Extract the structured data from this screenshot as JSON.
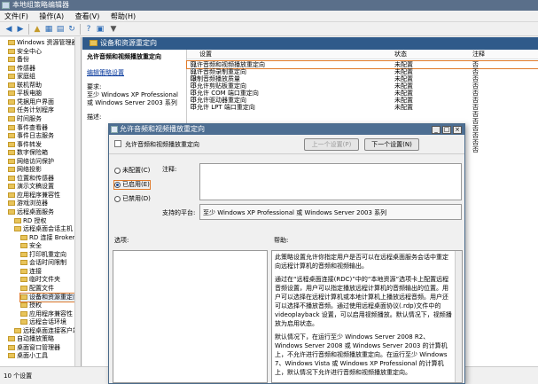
{
  "window": {
    "title": "本地组策略编辑器",
    "menu": [
      "文件(F)",
      "操作(A)",
      "查看(V)",
      "帮助(H)"
    ]
  },
  "tree": {
    "items": [
      {
        "label": "Windows 资源管理器",
        "indent": 1
      },
      {
        "label": "安全中心",
        "indent": 1
      },
      {
        "label": "备份",
        "indent": 1
      },
      {
        "label": "传感器",
        "indent": 1
      },
      {
        "label": "家庭组",
        "indent": 1
      },
      {
        "label": "联机帮助",
        "indent": 1
      },
      {
        "label": "平板电脑",
        "indent": 1
      },
      {
        "label": "凭据用户界面",
        "indent": 1
      },
      {
        "label": "任务计划程序",
        "indent": 1
      },
      {
        "label": "时间服务",
        "indent": 1
      },
      {
        "label": "事件查看器",
        "indent": 1
      },
      {
        "label": "事件日志服务",
        "indent": 1
      },
      {
        "label": "事件转发",
        "indent": 1
      },
      {
        "label": "数字保险箱",
        "indent": 1
      },
      {
        "label": "网络访问保护",
        "indent": 1
      },
      {
        "label": "网络投影",
        "indent": 1
      },
      {
        "label": "位置和传感器",
        "indent": 1
      },
      {
        "label": "演示文稿设置",
        "indent": 1
      },
      {
        "label": "应用程序兼容性",
        "indent": 1
      },
      {
        "label": "游戏浏览器",
        "indent": 1
      },
      {
        "label": "远程桌面服务",
        "indent": 1
      },
      {
        "label": "RD 授权",
        "indent": 2
      },
      {
        "label": "远程桌面会话主机",
        "indent": 2
      },
      {
        "label": "RD 连接 Broker",
        "indent": 3
      },
      {
        "label": "安全",
        "indent": 3
      },
      {
        "label": "打印机重定向",
        "indent": 3
      },
      {
        "label": "会话时间限制",
        "indent": 3
      },
      {
        "label": "连接",
        "indent": 3
      },
      {
        "label": "临时文件夹",
        "indent": 3
      },
      {
        "label": "配置文件",
        "indent": 3
      },
      {
        "label": "设备和资源重定向",
        "indent": 3,
        "selected": true
      },
      {
        "label": "授权",
        "indent": 3
      },
      {
        "label": "应用程序兼容性",
        "indent": 3
      },
      {
        "label": "远程会话环境",
        "indent": 3
      },
      {
        "label": "远程桌面连接客户端",
        "indent": 2
      },
      {
        "label": "自动播放策略",
        "indent": 1
      },
      {
        "label": "桌面窗口管理器",
        "indent": 1
      },
      {
        "label": "桌面小工具",
        "indent": 1
      }
    ]
  },
  "right": {
    "header": "设备和资源重定向",
    "ext_title": "允许音频和视频播放重定向",
    "ext_edit_link": "编辑策略设置",
    "ext_req_label": "要求:",
    "ext_req_text": "至少 Windows XP Professional 或 Windows Server 2003 系列",
    "ext_desc_label": "描述:",
    "columns": [
      "设置",
      "状态",
      "注释"
    ],
    "rows": [
      {
        "setting": "允许音频和视频播放重定向",
        "state": "未配置",
        "note": "否",
        "selected": true
      },
      {
        "setting": "允许音频录制重定向",
        "state": "未配置",
        "note": "否"
      },
      {
        "setting": "限制音频播放质量",
        "state": "未配置",
        "note": "否"
      },
      {
        "setting": "不允许剪贴板重定向",
        "state": "未配置",
        "note": "否"
      },
      {
        "setting": "不允许 COM 端口重定向",
        "state": "未配置",
        "note": "否"
      },
      {
        "setting": "不允许驱动器重定向",
        "state": "未配置",
        "note": "否"
      },
      {
        "setting": "不允许 LPT 端口重定向",
        "state": "未配置",
        "note": "否"
      }
    ],
    "extra_notes": [
      "否",
      "否",
      "否",
      "否",
      "否",
      "否"
    ]
  },
  "status": {
    "text": "10 个设置"
  },
  "dialog": {
    "title": "允许音频和视频播放重定向",
    "policy_name": "允许音频和视频播放重定向",
    "prev_btn": "上一个设置(P)",
    "next_btn": "下一个设置(N)",
    "opt_not_configured": "未配置(C)",
    "opt_enabled": "已启用(E)",
    "opt_disabled": "已禁用(D)",
    "comment_label": "注释:",
    "supported_label": "支持的平台:",
    "supported_text": "至少 Windows XP Professional 或 Windows Server 2003 系列",
    "options_label": "选项:",
    "help_label": "帮助:",
    "help_paras": [
      "此策略设置允许你指定用户是否可以在远程桌面服务会话中重定向远程计算机的音频和视频输出。",
      "通过在“远程桌面连接(RDC)”中的“本地资源”选项卡上配置远程音频设置，用户可以指定播放远程计算机的音频输出的位置。用户可以选择在远程计算机或本地计算机上播放远程音频。用户还可以选择不播放音频。通过使用远程桌面协议(.rdp)文件中的 videoplayback 设置，可以启用视频播放。默认情况下，视频播放为启用状态。",
      "默认情况下，在运行至少 Windows Server 2008 R2、Windows Server 2008 或 Windows Server 2003 的计算机上，不允许进行音频和视频播放重定向。在运行至少 Windows 7、Windows Vista 或 Windows XP Professional 的计算机上，默认情况下允许进行音频和视频播放重定向。"
    ]
  }
}
